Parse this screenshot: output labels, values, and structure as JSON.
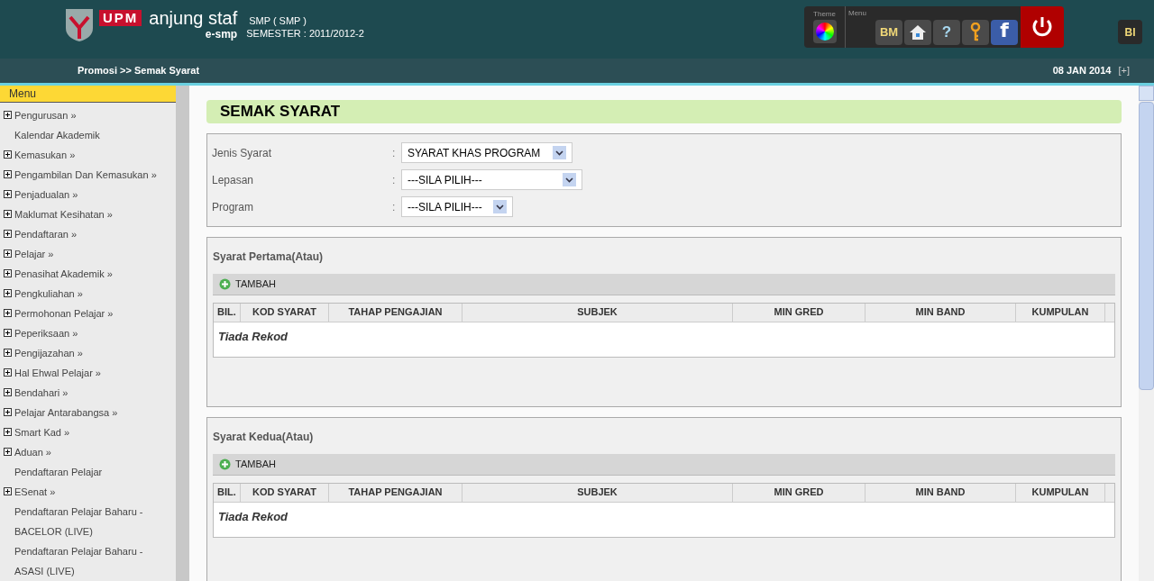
{
  "header": {
    "logo_text": "UPM",
    "app_name": "anjung staf",
    "app_sub": "e-smp",
    "system": "SMP ( SMP )",
    "semester": "SEMESTER : 2011/2012-2",
    "theme_label": "Theme",
    "menu_label": "Menu",
    "menu_buttons": [
      {
        "kind": "text",
        "label": "BM"
      },
      {
        "kind": "home"
      },
      {
        "kind": "help",
        "label": "?"
      },
      {
        "kind": "key"
      },
      {
        "kind": "facebook",
        "label": "f"
      }
    ],
    "language_button": "BI"
  },
  "breadcrumb": "Promosi >> Semak Syarat",
  "date": "08 JAN 2014",
  "expand": "[+]",
  "sidebar": {
    "title": "Menu",
    "items": [
      {
        "label": "Pengurusan »",
        "expandable": true
      },
      {
        "label": "Kalendar Akademik",
        "expandable": false
      },
      {
        "label": "Kemasukan »",
        "expandable": true
      },
      {
        "label": "Pengambilan Dan Kemasukan »",
        "expandable": true
      },
      {
        "label": "Penjadualan »",
        "expandable": true
      },
      {
        "label": "Maklumat Kesihatan »",
        "expandable": true
      },
      {
        "label": "Pendaftaran »",
        "expandable": true
      },
      {
        "label": "Pelajar »",
        "expandable": true
      },
      {
        "label": "Penasihat Akademik »",
        "expandable": true
      },
      {
        "label": "Pengkuliahan »",
        "expandable": true
      },
      {
        "label": "Permohonan Pelajar »",
        "expandable": true
      },
      {
        "label": "Peperiksaan »",
        "expandable": true
      },
      {
        "label": "Pengijazahan »",
        "expandable": true
      },
      {
        "label": "Hal Ehwal Pelajar »",
        "expandable": true
      },
      {
        "label": "Bendahari »",
        "expandable": true
      },
      {
        "label": "Pelajar Antarabangsa »",
        "expandable": true
      },
      {
        "label": "Smart Kad »",
        "expandable": true
      },
      {
        "label": "Aduan »",
        "expandable": true
      },
      {
        "label": "Pendaftaran Pelajar",
        "expandable": false
      },
      {
        "label": "ESenat »",
        "expandable": true
      },
      {
        "label": "Pendaftaran Pelajar Baharu - BACELOR (LIVE)",
        "expandable": false
      },
      {
        "label": "Pendaftaran Pelajar Baharu - ASASI (LIVE)",
        "expandable": false
      }
    ]
  },
  "page_title": "SEMAK SYARAT",
  "form": [
    {
      "label": "Jenis Syarat",
      "separator": ":",
      "value": "SYARAT KHAS PROGRAM"
    },
    {
      "label": "Lepasan",
      "separator": ":",
      "value": "---SILA PILIH---"
    },
    {
      "label": "Program",
      "separator": ":",
      "value": "---SILA PILIH---"
    }
  ],
  "sections": [
    {
      "title": "Syarat Pertama(Atau)",
      "add_button": "TAMBAH",
      "columns": [
        "BIL.",
        "KOD SYARAT",
        "TAHAP PENGAJIAN",
        "SUBJEK",
        "MIN GRED",
        "MIN BAND",
        "KUMPULAN"
      ],
      "empty": "Tiada Rekod"
    },
    {
      "title": "Syarat Kedua(Atau)",
      "add_button": "TAMBAH",
      "columns": [
        "BIL.",
        "KOD SYARAT",
        "TAHAP PENGAJIAN",
        "SUBJEK",
        "MIN GRED",
        "MIN BAND",
        "KUMPULAN"
      ],
      "empty": "Tiada Rekod"
    }
  ]
}
